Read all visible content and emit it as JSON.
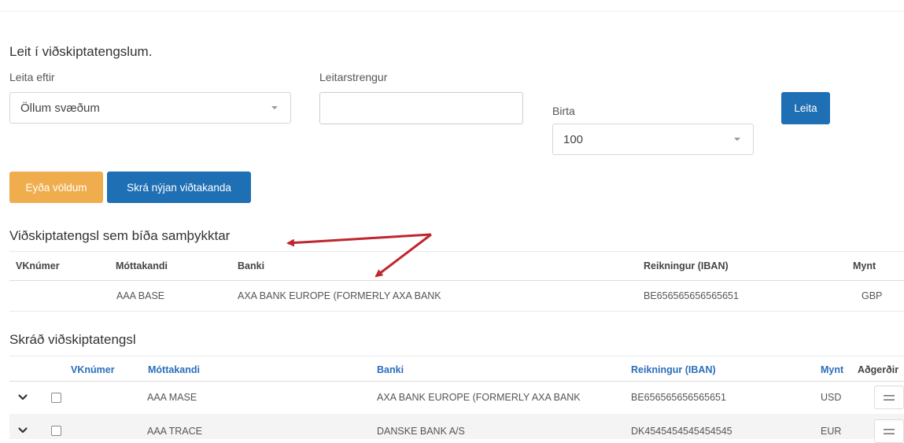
{
  "search": {
    "title": "Leit í viðskiptatengslum.",
    "search_by_label": "Leita eftir",
    "search_by_value": "Öllum svæðum",
    "search_string_label": "Leitarstrengur",
    "search_string_value": "",
    "show_label": "Birta",
    "show_value": "100",
    "search_button": "Leita"
  },
  "actions": {
    "delete_selected": "Eyða völdum",
    "register_new": "Skrá nýjan viðtakanda"
  },
  "pending": {
    "title": "Viðskiptatengsl sem bíða samþykktar",
    "columns": [
      "VKnúmer",
      "Móttakandi",
      "Banki",
      "Reikningur (IBAN)",
      "Mynt"
    ],
    "rows": [
      {
        "vk": "",
        "recipient": "AAA BASE",
        "bank": "AXA BANK EUROPE (FORMERLY AXA BANK",
        "iban": "BE656565656565651",
        "currency": "GBP"
      }
    ]
  },
  "registered": {
    "title": "Skráð viðskiptatengsl",
    "columns": [
      "VKnúmer",
      "Móttakandi",
      "Banki",
      "Reikningur (IBAN)",
      "Mynt",
      "Aðgerðir"
    ],
    "rows": [
      {
        "vk": "",
        "recipient": "AAA MASE",
        "bank": "AXA BANK EUROPE (FORMERLY AXA BANK",
        "iban": "BE656565656565651",
        "currency": "USD"
      },
      {
        "vk": "",
        "recipient": "AAA TRACE",
        "bank": "DANSKE BANK A/S",
        "iban": "DK4545454545454545",
        "currency": "EUR"
      }
    ]
  },
  "annotation": {
    "color": "#c0262d",
    "icon": "red-arrow-annotation"
  },
  "icons": {
    "row_expand": "chevron-down-icon",
    "row_select": "checkbox",
    "row_actions": "hamburger-menu-icon",
    "dropdown": "caret-down-icon"
  }
}
